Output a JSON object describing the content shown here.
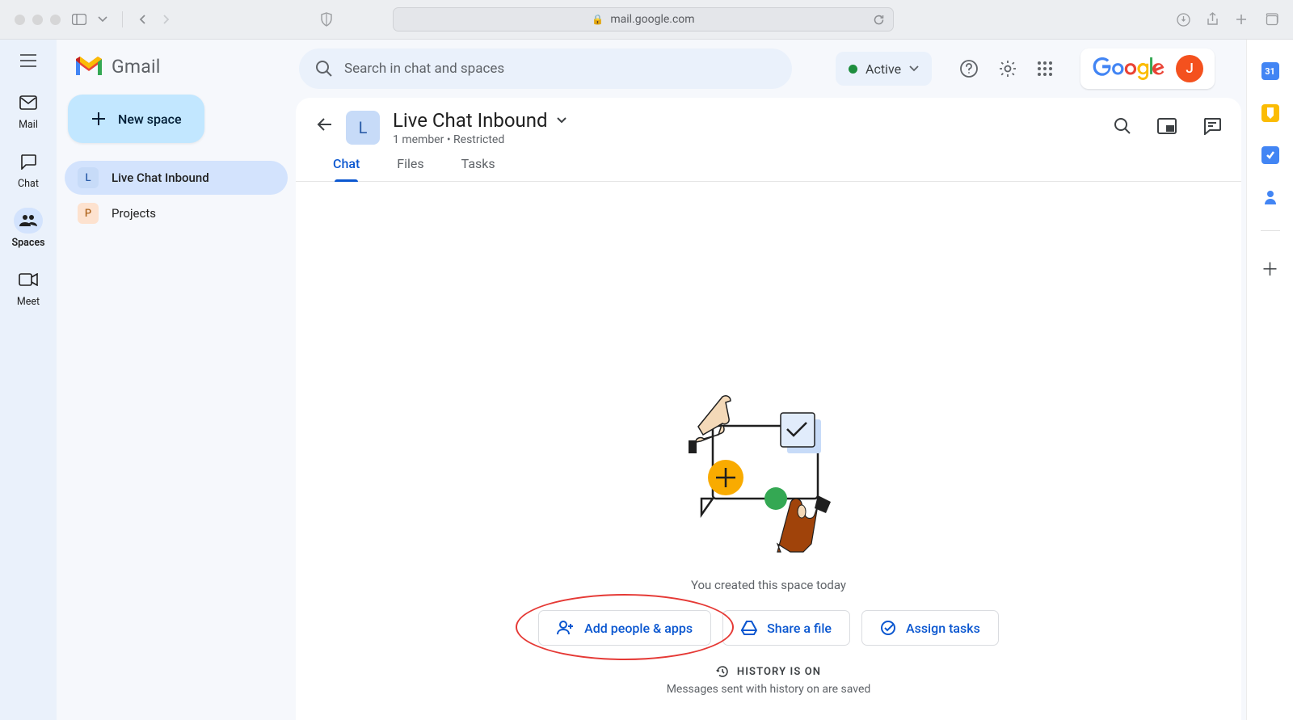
{
  "browser": {
    "url": "mail.google.com"
  },
  "app_name": "Gmail",
  "rail": {
    "items": [
      {
        "label": "Mail"
      },
      {
        "label": "Chat"
      },
      {
        "label": "Spaces"
      },
      {
        "label": "Meet"
      }
    ]
  },
  "new_space_label": "New space",
  "spaces": [
    {
      "initial": "L",
      "label": "Live Chat Inbound",
      "selected": true
    },
    {
      "initial": "P",
      "label": "Projects",
      "selected": false
    }
  ],
  "search": {
    "placeholder": "Search in chat and spaces"
  },
  "status": {
    "label": "Active"
  },
  "google_label": "Google",
  "profile_initial": "J",
  "space_header": {
    "initial": "L",
    "title": "Live Chat Inbound",
    "subtitle": "1 member  •  Restricted"
  },
  "tabs": [
    {
      "label": "Chat",
      "active": true
    },
    {
      "label": "Files",
      "active": false
    },
    {
      "label": "Tasks",
      "active": false
    }
  ],
  "empty": {
    "created_text": "You created this space today",
    "actions": {
      "add": "Add people & apps",
      "share": "Share a file",
      "assign": "Assign tasks"
    },
    "history_title": "HISTORY IS ON",
    "history_sub": "Messages sent with history on are saved"
  },
  "right_rail": {
    "calendar_day": "31"
  }
}
